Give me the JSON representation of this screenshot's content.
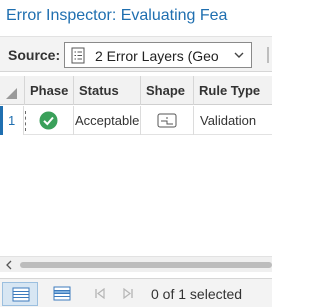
{
  "title": "Error Inspector: Evaluating Fea",
  "source": {
    "label": "Source:",
    "value": "2 Error Layers (Geo",
    "icon": "document-list-icon"
  },
  "table": {
    "columns": [
      "Phase",
      "Status",
      "Shape",
      "Rule Type"
    ],
    "rows": [
      {
        "num": "1",
        "phase_icon": "check-circle-icon",
        "status": "Acceptable",
        "shape_icon": "polyline-shape-icon",
        "rule_type": "Validation"
      }
    ]
  },
  "status_bar": {
    "selection_text": "0 of 1 selected"
  },
  "colors": {
    "accent": "#1f6fb0",
    "check_green": "#3aa05a"
  }
}
